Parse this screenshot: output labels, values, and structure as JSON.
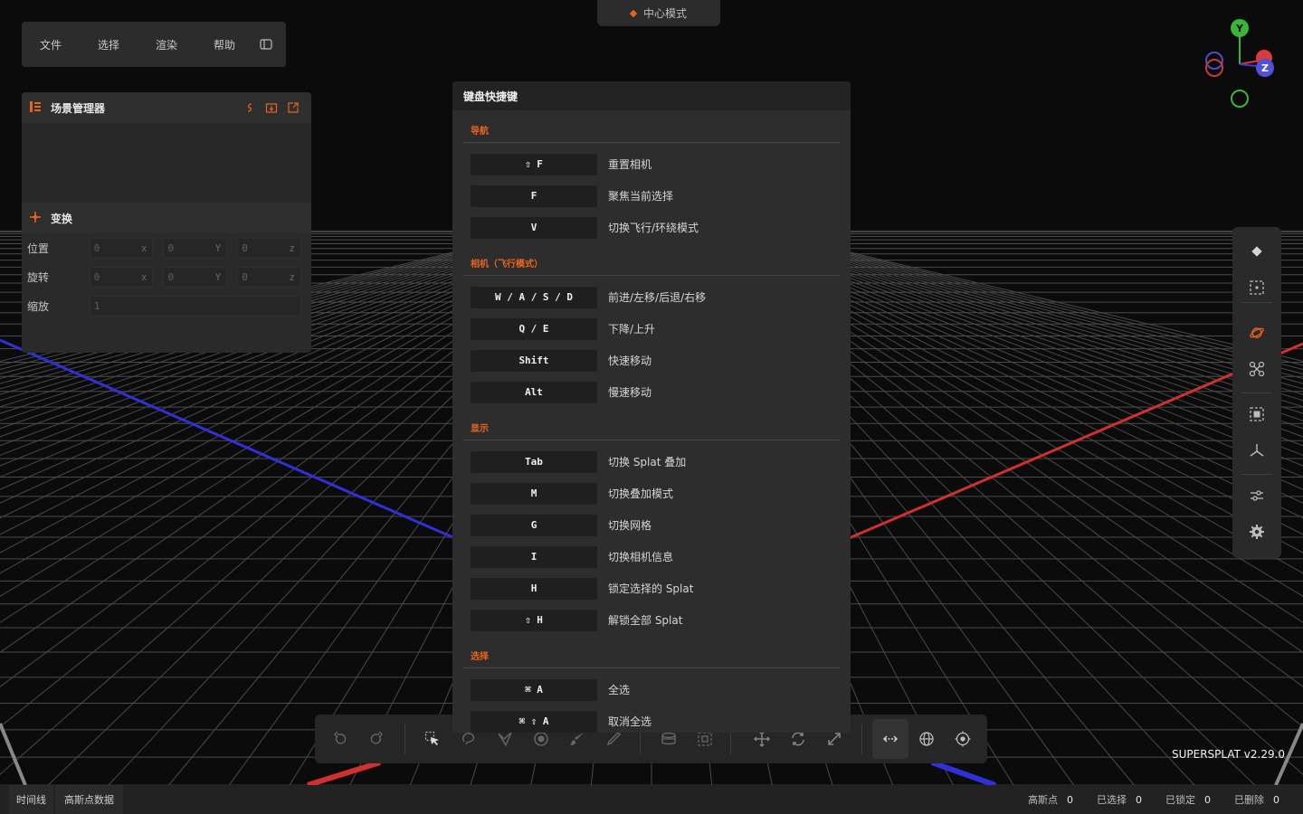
{
  "mode_pill": {
    "label": "中心模式"
  },
  "menubar": {
    "items": [
      "文件",
      "选择",
      "渲染",
      "帮助"
    ]
  },
  "scene_panel": {
    "title": "场景管理器",
    "transform": {
      "title": "变换",
      "position": {
        "label": "位置",
        "values": [
          "0",
          "0",
          "0"
        ],
        "axes": [
          "x",
          "Y",
          "z"
        ]
      },
      "rotation": {
        "label": "旋转",
        "values": [
          "0",
          "0",
          "0"
        ],
        "axes": [
          "x",
          "Y",
          "z"
        ]
      },
      "scale": {
        "label": "缩放",
        "value": "1"
      }
    }
  },
  "gizmo": {
    "axes": [
      "Y",
      "Z"
    ]
  },
  "dialog": {
    "title": "键盘快捷键",
    "sections": [
      {
        "title": "导航",
        "rows": [
          {
            "key": "⇧ F",
            "desc": "重置相机"
          },
          {
            "key": "F",
            "desc": "聚焦当前选择"
          },
          {
            "key": "V",
            "desc": "切换飞行/环绕模式"
          }
        ]
      },
      {
        "title": "相机（飞行模式）",
        "rows": [
          {
            "key": "W / A / S / D",
            "desc": "前进/左移/后退/右移"
          },
          {
            "key": "Q / E",
            "desc": "下降/上升"
          },
          {
            "key": "Shift",
            "desc": "快速移动"
          },
          {
            "key": "Alt",
            "desc": "慢速移动"
          }
        ]
      },
      {
        "title": "显示",
        "rows": [
          {
            "key": "Tab",
            "desc": "切换 Splat 叠加"
          },
          {
            "key": "M",
            "desc": "切换叠加模式"
          },
          {
            "key": "G",
            "desc": "切换网格"
          },
          {
            "key": "I",
            "desc": "切换相机信息"
          },
          {
            "key": "H",
            "desc": "锁定选择的 Splat"
          },
          {
            "key": "⇧ H",
            "desc": "解锁全部 Splat"
          }
        ]
      },
      {
        "title": "选择",
        "rows": [
          {
            "key": "⌘ A",
            "desc": "全选"
          },
          {
            "key": "⌘ ⇧ A",
            "desc": "取消全选"
          }
        ]
      }
    ]
  },
  "version": "SUPERSPLAT v2.29.0",
  "statusbar": {
    "buttons": [
      "时间线",
      "高斯点数据"
    ],
    "stats": [
      {
        "label": "高斯点",
        "value": "0"
      },
      {
        "label": "已选择",
        "value": "0"
      },
      {
        "label": "已锁定",
        "value": "0"
      },
      {
        "label": "已删除",
        "value": "0"
      }
    ]
  },
  "colors": {
    "accent": "#e8641e",
    "x_axis": "#d93a3a",
    "y_axis": "#3ab53a",
    "z_axis": "#3a3ad9"
  },
  "icons": {
    "right_toolbar": [
      "diamond-icon",
      "frame-focus-icon",
      "orbit-icon",
      "fly-drone-icon",
      "bounding-box-icon",
      "axes-icon",
      "sliders-icon",
      "gear-icon"
    ],
    "bottom_toolbar": [
      "undo-icon",
      "redo-icon",
      "pointer-select-icon",
      "lasso-icon",
      "polygon-icon",
      "sphere-select-icon",
      "brush-icon",
      "eyedropper-icon",
      "filter-icon",
      "box-select-icon",
      "move-icon",
      "rotate-icon",
      "scale-icon",
      "measure-icon",
      "globe-icon",
      "pivot-icon"
    ]
  }
}
